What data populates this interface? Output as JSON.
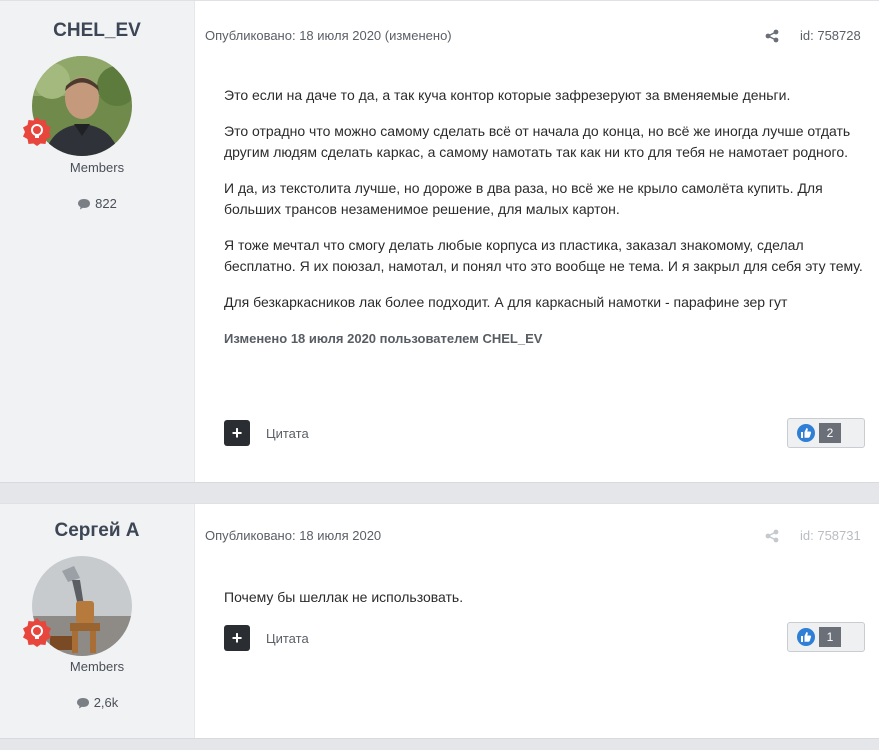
{
  "posts": [
    {
      "author": {
        "name": "CHEL_EV",
        "group": "Members",
        "post_count": "822"
      },
      "published": "Опубликовано: 18 июля 2020 (изменено)",
      "post_id": "id: 758728",
      "paragraphs": [
        "Это если на даче то да, а так куча контор которые зафрезеруют за вменяемые деньги.",
        "Это отрадно что можно самому сделать всё от начала до конца, но всё же иногда лучше отдать другим людям сделать каркас, а самому намотать так как ни кто для тебя не намотает родного.",
        "И да, из текстолита лучше, но дороже в два раза, но всё же не крыло самолёта купить. Для больших трансов незаменимое решение, для малых картон.",
        "Я тоже мечтал что смогу делать любые корпуса из пластика, заказал знакомому, сделал бесплатно. Я их поюзал, намотал, и понял что это вообще не тема. И я закрыл для себя эту тему.",
        "Для безкаркасников лак более подходит. А для каркасный намотки - парафине зер гут"
      ],
      "edited_note": "Изменено 18 июля 2020 пользователем CHEL_EV",
      "quote_label": "Цитата",
      "reaction_count": "2"
    },
    {
      "author": {
        "name": "Сергей А",
        "group": "Members",
        "post_count": "2,6k"
      },
      "published": "Опубликовано: 18 июля 2020",
      "post_id": "id: 758731",
      "paragraphs": [
        "Почему бы шеллак не использовать."
      ],
      "quote_label": "Цитата",
      "reaction_count": "1"
    }
  ],
  "colors": {
    "accent_badge": "#e8453c",
    "like_blue": "#2f7fd6",
    "page_bg": "#e4e6e9"
  },
  "icons": {
    "share": "share-icon",
    "comment": "comment-icon",
    "badge": "rank-badge-icon",
    "like": "like-icon",
    "multiquote": "plus-icon"
  }
}
